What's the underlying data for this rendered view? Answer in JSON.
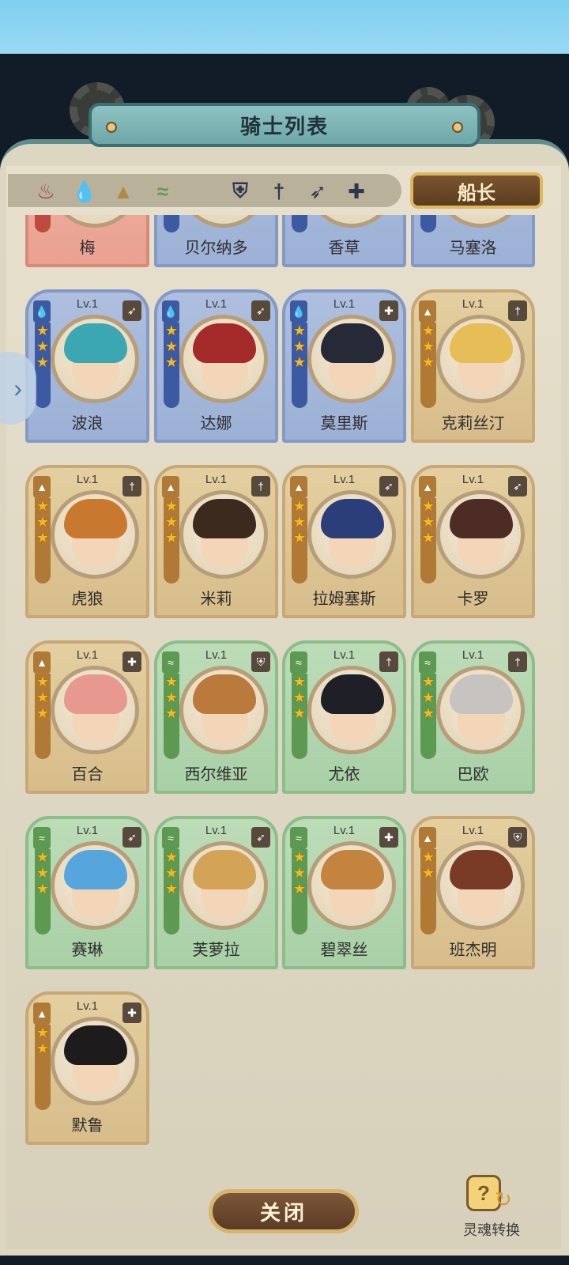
{
  "header": {
    "title": "骑士列表"
  },
  "filters": {
    "elements": [
      {
        "icon": "fire-element-icon",
        "glyph": "♨",
        "color": "#a63a3a"
      },
      {
        "icon": "water-element-icon",
        "glyph": "💧",
        "color": "#3f68b5"
      },
      {
        "icon": "earth-element-icon",
        "glyph": "▲",
        "color": "#b08a45"
      },
      {
        "icon": "wind-element-icon",
        "glyph": "≈",
        "color": "#5aa04d"
      }
    ],
    "classes": [
      {
        "icon": "shield-class-icon",
        "glyph": "⛨",
        "color": "#2c3850"
      },
      {
        "icon": "sword-class-icon",
        "glyph": "†",
        "color": "#2c3850"
      },
      {
        "icon": "bow-class-icon",
        "glyph": "➶",
        "color": "#2c3850"
      },
      {
        "icon": "healer-class-icon",
        "glyph": "✚",
        "color": "#2c3850"
      }
    ],
    "captain_label": "船长"
  },
  "partial_row": [
    {
      "name": "梅",
      "color": "red"
    },
    {
      "name": "贝尔纳多",
      "color": "blue"
    },
    {
      "name": "香草",
      "color": "blue"
    },
    {
      "name": "马塞洛",
      "color": "blue"
    }
  ],
  "knights": [
    {
      "name": "波浪",
      "level": "Lv.1",
      "color": "blue",
      "element": "water-element-icon",
      "class": "bow-class-icon",
      "stars": 3,
      "hair": "#3aa7b3"
    },
    {
      "name": "达娜",
      "level": "Lv.1",
      "color": "blue",
      "element": "water-element-icon",
      "class": "bow-class-icon",
      "stars": 3,
      "hair": "#a32a28"
    },
    {
      "name": "莫里斯",
      "level": "Lv.1",
      "color": "blue",
      "element": "water-element-icon",
      "class": "healer-class-icon",
      "stars": 3,
      "hair": "#262a36"
    },
    {
      "name": "克莉丝汀",
      "level": "Lv.1",
      "color": "gold",
      "element": "earth-element-icon",
      "class": "sword-class-icon",
      "stars": 3,
      "hair": "#e6bd56"
    },
    {
      "name": "虎狼",
      "level": "Lv.1",
      "color": "gold",
      "element": "earth-element-icon",
      "class": "sword-class-icon",
      "stars": 3,
      "hair": "#c9792f"
    },
    {
      "name": "米莉",
      "level": "Lv.1",
      "color": "gold",
      "element": "earth-element-icon",
      "class": "sword-class-icon",
      "stars": 3,
      "hair": "#3b2a1d"
    },
    {
      "name": "拉姆塞斯",
      "level": "Lv.1",
      "color": "gold",
      "element": "earth-element-icon",
      "class": "bow-class-icon",
      "stars": 3,
      "hair": "#2c3e7a"
    },
    {
      "name": "卡罗",
      "level": "Lv.1",
      "color": "gold",
      "element": "earth-element-icon",
      "class": "bow-class-icon",
      "stars": 3,
      "hair": "#4e2c26"
    },
    {
      "name": "百合",
      "level": "Lv.1",
      "color": "gold",
      "element": "earth-element-icon",
      "class": "healer-class-icon",
      "stars": 3,
      "hair": "#e7988f"
    },
    {
      "name": "西尔维亚",
      "level": "Lv.1",
      "color": "green",
      "element": "wind-element-icon",
      "class": "shield-class-icon",
      "stars": 3,
      "hair": "#b97a3c"
    },
    {
      "name": "尤依",
      "level": "Lv.1",
      "color": "green",
      "element": "wind-element-icon",
      "class": "sword-class-icon",
      "stars": 3,
      "hair": "#1f1f28"
    },
    {
      "name": "巴欧",
      "level": "Lv.1",
      "color": "green",
      "element": "wind-element-icon",
      "class": "sword-class-icon",
      "stars": 3,
      "hair": "#c7c3c0"
    },
    {
      "name": "赛琳",
      "level": "Lv.1",
      "color": "green",
      "element": "wind-element-icon",
      "class": "bow-class-icon",
      "stars": 3,
      "hair": "#56a6dd"
    },
    {
      "name": "芙萝拉",
      "level": "Lv.1",
      "color": "green",
      "element": "wind-element-icon",
      "class": "bow-class-icon",
      "stars": 3,
      "hair": "#d3a457"
    },
    {
      "name": "碧翠丝",
      "level": "Lv.1",
      "color": "green",
      "element": "wind-element-icon",
      "class": "healer-class-icon",
      "stars": 3,
      "hair": "#c3843f"
    },
    {
      "name": "班杰明",
      "level": "Lv.1",
      "color": "gold",
      "element": "earth-element-icon",
      "class": "shield-class-icon",
      "stars": 2,
      "hair": "#7a3b26"
    },
    {
      "name": "默鲁",
      "level": "Lv.1",
      "color": "gold",
      "element": "earth-element-icon",
      "class": "healer-class-icon",
      "stars": 2,
      "hair": "#1d1b1c"
    }
  ],
  "footer": {
    "close_label": "关闭",
    "soul_label": "灵魂转换",
    "soul_glyph": "?"
  },
  "colors": {
    "blue_strip": "#3c5aa2",
    "gold_strip": "#b07a36",
    "green_strip": "#5c9a52",
    "red_strip": "#c04a3d"
  }
}
